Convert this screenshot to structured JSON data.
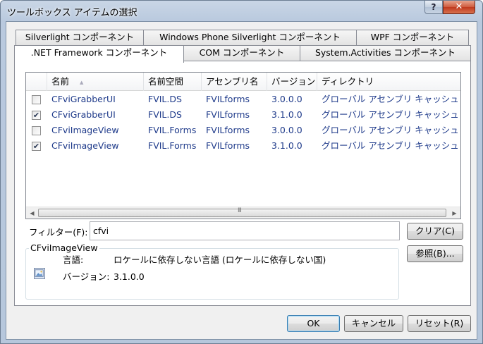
{
  "window": {
    "title": "ツールボックス アイテムの選択",
    "help_label": "?",
    "close_label": "✕"
  },
  "tabs": [
    {
      "label": "Silverlight コンポーネント"
    },
    {
      "label": "Windows Phone Silverlight コンポーネント"
    },
    {
      "label": "WPF コンポーネント"
    },
    {
      "label": ".NET Framework コンポーネント"
    },
    {
      "label": "COM コンポーネント"
    },
    {
      "label": "System.Activities コンポーネント"
    }
  ],
  "active_tab": ".NET Framework コンポーネント",
  "table": {
    "columns": [
      "名前",
      "名前空間",
      "アセンブリ名",
      "バージョン",
      "ディレクトリ"
    ],
    "sort_column": "名前",
    "sort_indicator": "▲",
    "rows": [
      {
        "checked": false,
        "check_mark": "",
        "name": "CFviGrabberUI",
        "namespace": "FVIL.DS",
        "assembly": "FVILforms",
        "version": "3.0.0.0",
        "directory": "グローバル アセンブリ キャッシュ"
      },
      {
        "checked": true,
        "check_mark": "✔",
        "name": "CFviGrabberUI",
        "namespace": "FVIL.DS",
        "assembly": "FVILforms",
        "version": "3.1.0.0",
        "directory": "グローバル アセンブリ キャッシュ"
      },
      {
        "checked": false,
        "check_mark": "",
        "name": "CFviImageView",
        "namespace": "FVIL.Forms",
        "assembly": "FVILforms",
        "version": "3.0.0.0",
        "directory": "グローバル アセンブリ キャッシュ"
      },
      {
        "checked": true,
        "check_mark": "✔",
        "name": "CFviImageView",
        "namespace": "FVIL.Forms",
        "assembly": "FVILforms",
        "version": "3.1.0.0",
        "directory": "グローバル アセンブリ キャッシュ"
      }
    ]
  },
  "scrollbar": {
    "left_arrow": "◀",
    "right_arrow": "▶",
    "grip": "III"
  },
  "filter": {
    "label": "フィルター(F):",
    "value": "cfvi",
    "clear_label": "クリア(C)"
  },
  "details": {
    "title": "CFviImageView",
    "language_label": "言語:",
    "language_value": "ロケールに依存しない言語 (ロケールに依存しない国)",
    "version_label": "バージョン:",
    "version_value": "3.1.0.0",
    "browse_label": "参照(B)..."
  },
  "footer": {
    "ok_label": "OK",
    "cancel_label": "キャンセル",
    "reset_label": "リセット(R)"
  }
}
